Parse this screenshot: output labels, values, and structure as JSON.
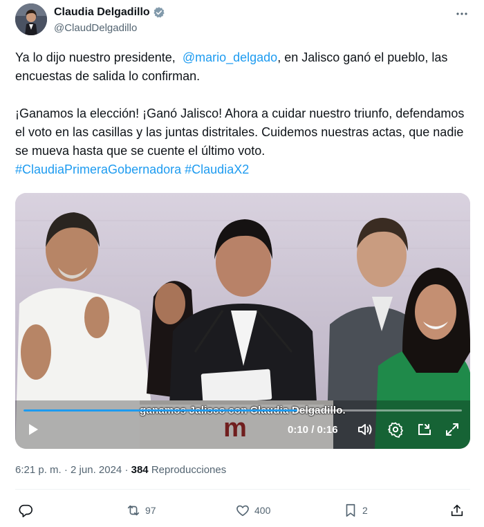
{
  "author": {
    "name": "Claudia Delgadillo",
    "handle": "@ClaudDelgadillo"
  },
  "tweet": {
    "line1_before": "Ya lo dijo nuestro presidente,  ",
    "mention": "@mario_delgado",
    "line1_after": ", en Jalisco ganó el pueblo, las encuestas de salida lo confirman.",
    "paragraph2": "¡Ganamos la elección! ¡Ganó Jalisco! Ahora a cuidar nuestro triunfo, defendamos el voto en las casillas y las juntas distritales. Cuidemos nuestras actas, que nadie se mueva hasta que se cuente el último voto.",
    "hashtag1": "#ClaudiaPrimeraGobernadora",
    "hashtag2": "#ClaudiaX2"
  },
  "video": {
    "caption": "ganamos Jalisco con Claudia Delgadillo.",
    "time": "0:10 / 0:16",
    "progress": 0.625,
    "podium_logo": "m"
  },
  "meta": {
    "time": "6:21 p. m.",
    "date": "2 jun. 2024",
    "views": "384",
    "views_label": "Reproducciones"
  },
  "actions": {
    "retweets": "97",
    "likes": "400",
    "bookmarks": "2"
  },
  "colors": {
    "link": "#1d9bf0",
    "text": "#0f1419",
    "muted": "#536471",
    "verified": "#829aab",
    "podium_accent": "#9b2a2a"
  }
}
